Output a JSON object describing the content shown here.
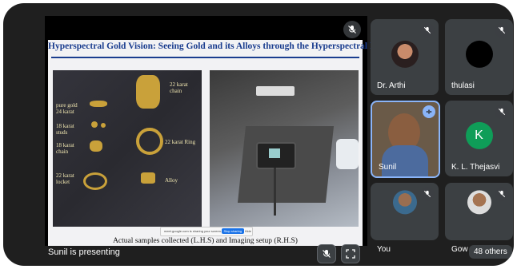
{
  "slide": {
    "title": "Hyperspectral Gold Vision: Seeing Gold and its Alloys through the Hyperspectral Eye",
    "caption": "Actual samples collected (L.H.S) and Imaging setup (R.H.S)",
    "labels": {
      "karat22_chain": "22 karat\nchain",
      "pure_gold": "pure gold\n24 karat",
      "studs": "18 karat\nstuds",
      "chain18": "18 karat\nchain",
      "ring22": "22 karat Ring",
      "locket22": "22 karat\nlocket",
      "alloy": "Alloy"
    },
    "share_text": "meet.google.com is sharing your screen.",
    "stop_sharing": "Stop sharing",
    "hide": "Hide"
  },
  "presenting_label": "Sunil is presenting",
  "participants": [
    {
      "name": "Dr. Arthi"
    },
    {
      "name": "thulasi"
    },
    {
      "name": "Sunil"
    },
    {
      "name": "K. L. Thejasvi",
      "initial": "K"
    },
    {
      "name": "You"
    },
    {
      "name": "Gow"
    }
  ],
  "others_count": "48 others",
  "colors": {
    "accent_ring": "#8ab4f8",
    "avatar_k": "#0f9d58"
  }
}
